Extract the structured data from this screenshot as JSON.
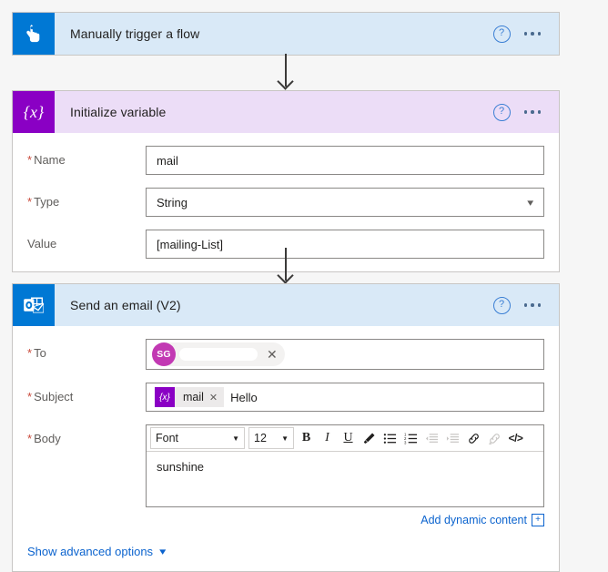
{
  "theme": {
    "page_background": "#f6f6f6",
    "trigger_accent": "#0078d4",
    "variable_accent": "#8a00c4",
    "outlook_accent": "#0078d4",
    "link_color": "#0b63ce",
    "required_marker": "#c94a3b",
    "avatar_color": "#c239b3",
    "trigger_header_bg": "#d9e9f7",
    "variable_header_bg": "#ecddf7"
  },
  "trigger_card": {
    "icon_name": "manual-trigger-hand-icon",
    "title": "Manually trigger a flow",
    "help_label": "?",
    "menu_label": "..."
  },
  "variable_card": {
    "icon_name": "initialize-variable-braces-icon",
    "icon_text": "{x}",
    "title": "Initialize variable",
    "help_label": "?",
    "menu_label": "...",
    "fields": [
      {
        "label": "Name",
        "required": true,
        "value": "mail",
        "control": "text"
      },
      {
        "label": "Type",
        "required": true,
        "value": "String",
        "control": "select"
      },
      {
        "label": "Value",
        "required": false,
        "value": "[mailing-List]",
        "control": "text"
      }
    ]
  },
  "email_card": {
    "icon_name": "outlook-icon",
    "title": "Send an email (V2)",
    "help_label": "?",
    "menu_label": "...",
    "to": {
      "label": "To",
      "required": true,
      "avatar_initials": "SG",
      "recipient_redacted": "",
      "remove_label": "✕"
    },
    "subject": {
      "label": "Subject",
      "required": true,
      "token_icon_text": "{x}",
      "token_label": "mail",
      "token_remove_label": "✕",
      "text": "Hello"
    },
    "body": {
      "label": "Body",
      "required": true,
      "text": "sunshine",
      "toolbar": {
        "font_label": "Font",
        "font_caret": "▼",
        "size_label": "12",
        "size_caret": "▼",
        "buttons": [
          {
            "name": "bold-icon",
            "glyph": "B",
            "disabled": false
          },
          {
            "name": "italic-icon",
            "glyph": "I",
            "disabled": false
          },
          {
            "name": "underline-icon",
            "glyph": "U",
            "disabled": false
          },
          {
            "name": "text-highlight-icon",
            "glyph": "",
            "disabled": false
          },
          {
            "name": "bulleted-list-icon",
            "glyph": "",
            "disabled": false
          },
          {
            "name": "numbered-list-icon",
            "glyph": "",
            "disabled": false
          },
          {
            "name": "decrease-indent-icon",
            "glyph": "",
            "disabled": true
          },
          {
            "name": "increase-indent-icon",
            "glyph": "",
            "disabled": true
          },
          {
            "name": "insert-link-icon",
            "glyph": "",
            "disabled": false
          },
          {
            "name": "remove-link-icon",
            "glyph": "",
            "disabled": true
          },
          {
            "name": "code-view-icon",
            "glyph": "</>",
            "disabled": false
          }
        ]
      }
    },
    "add_dynamic_content": {
      "label": "Add dynamic content",
      "plus_label": "+"
    },
    "advanced_options": {
      "label": "Show advanced options",
      "chevron": "⌄"
    }
  }
}
